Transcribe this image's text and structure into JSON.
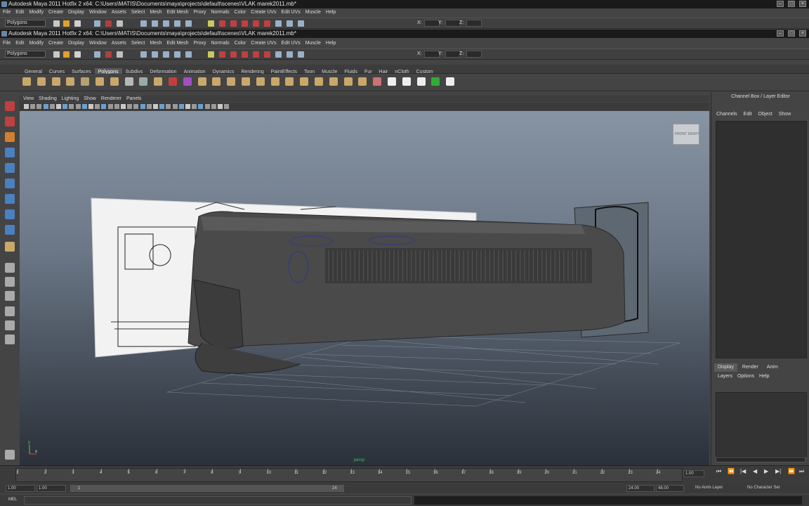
{
  "window": {
    "title": "Autodesk Maya 2011 Hotfix 2 x64: C:\\Users\\MATIS\\Documents\\maya\\projects\\default\\scenes\\VLAK marek2011.mb*"
  },
  "menubar": {
    "items": [
      "File",
      "Edit",
      "Modify",
      "Create",
      "Display",
      "Window",
      "Assets",
      "Select",
      "Mesh",
      "Edit Mesh",
      "Proxy",
      "Normals",
      "Color",
      "Create UVs",
      "Edit UVs",
      "Muscle",
      "Help"
    ]
  },
  "toolbar": {
    "menuset": "Polygons",
    "x_label": "X:",
    "y_label": "Y:",
    "z_label": "Z:"
  },
  "shelf": {
    "tabs": [
      "General",
      "Curves",
      "Surfaces",
      "Polygons",
      "Subdivs",
      "Deformation",
      "Animation",
      "Dynamics",
      "Rendering",
      "PaintEffects",
      "Toon",
      "Muscle",
      "Fluids",
      "Fur",
      "Hair",
      "nCloth",
      "Custom"
    ],
    "active_tab": "Polygons"
  },
  "panel": {
    "menu": [
      "View",
      "Shading",
      "Lighting",
      "Show",
      "Renderer",
      "Panels"
    ],
    "camera_label": "persp",
    "viewcube": [
      "FRONT",
      "RIGHT"
    ]
  },
  "channel_box": {
    "title": "Channel Box / Layer Editor",
    "menu": [
      "Channels",
      "Edit",
      "Object",
      "Show"
    ],
    "tabs": [
      "Display",
      "Render",
      "Anim"
    ],
    "active_tab": "Display",
    "layer_menu": [
      "Layers",
      "Options",
      "Help"
    ]
  },
  "timeline": {
    "ticks": [
      "1",
      "2",
      "3",
      "4",
      "5",
      "6",
      "7",
      "8",
      "9",
      "10",
      "11",
      "12",
      "13",
      "14",
      "15",
      "16",
      "17",
      "18",
      "19",
      "20",
      "21",
      "22",
      "23",
      "24"
    ],
    "current_frame": "1.00"
  },
  "range": {
    "start": "1.00",
    "start_inner": "1.00",
    "slider_start": "1",
    "slider_end": "24",
    "end_inner": "24.00",
    "end": "48.00",
    "anim_layer": "No Anim Layer",
    "char_set": "No Character Set"
  },
  "command": {
    "label": "MEL"
  },
  "colors": {
    "viewport_top": "#8794a3",
    "viewport_bottom": "#2b313a",
    "accent": "#5a5a5a"
  }
}
